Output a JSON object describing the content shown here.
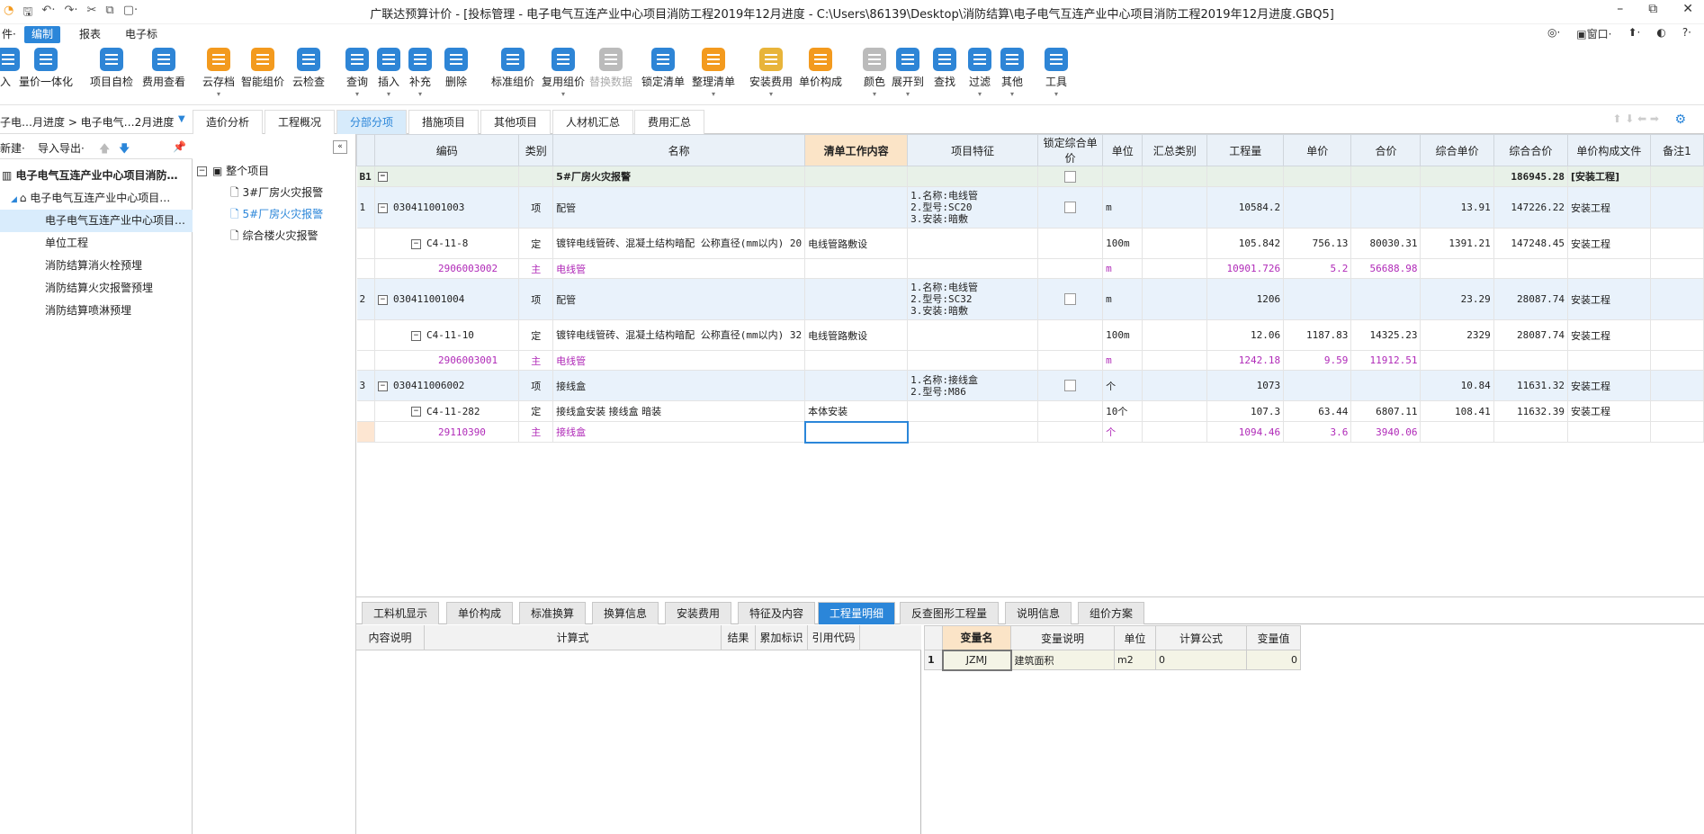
{
  "window": {
    "title": "广联达预算计价 - [投标管理 - 电子电气互连产业中心项目消防工程2019年12月进度 - C:\\Users\\86139\\Desktop\\消防结算\\电子电气互连产业中心项目消防工程2019年12月进度.GBQ5]"
  },
  "menu": {
    "items": [
      "件·",
      "编制",
      "报表",
      "电子标"
    ],
    "active": "编制",
    "right": [
      "◎·",
      "▣窗口·",
      "⬆·",
      "◐",
      "?·"
    ]
  },
  "toolbar": {
    "buttons": [
      "入",
      "量价一体化",
      "项目自检",
      "费用查看",
      "云存档",
      "智能组价",
      "云检查",
      "查询",
      "插入",
      "补充",
      "删除",
      "标准组价",
      "复用组价",
      "替换数据",
      "锁定清单",
      "整理清单",
      "安装费用",
      "单价构成",
      "颜色",
      "展开到",
      "查找",
      "过滤",
      "其他",
      "工具"
    ]
  },
  "left": {
    "breadcrumb": "子电…月进度 > 电子电气…2月进度",
    "new_label": "新建·",
    "import_label": "导入导出·",
    "tree": [
      "电子电气互连产业中心项目消防…",
      "电子电气互连产业中心项目…",
      "电子电气互连产业中心项目…",
      "单位工程",
      "消防结算消火栓预埋",
      "消防结算火灾报警预埋",
      "消防结算喷淋预埋"
    ]
  },
  "tabs": {
    "items": [
      "造价分析",
      "工程概况",
      "分部分项",
      "措施项目",
      "其他项目",
      "人材机汇总",
      "费用汇总"
    ],
    "active": "分部分项"
  },
  "mid": {
    "items": [
      "整个项目",
      "3#厂房火灾报警",
      "5#厂房火灾报警",
      "综合楼火灾报警"
    ],
    "selected": "5#厂房火灾报警"
  },
  "grid": {
    "headers": [
      "编码",
      "类别",
      "名称",
      "清单工作内容",
      "项目特征",
      "锁定综合单价",
      "单位",
      "汇总类别",
      "工程量",
      "单价",
      "合价",
      "综合单价",
      "综合合价",
      "单价构成文件",
      "备注1"
    ],
    "rows": [
      {
        "no": "B1",
        "code": "",
        "type": "",
        "name": "5#厂房火灾报警",
        "work": "",
        "feat": "",
        "unit": "",
        "qty": "",
        "price": "",
        "total": "",
        "uprice": "",
        "utotal": "186945.28",
        "file": "[安装工程]"
      },
      {
        "no": "1",
        "code": "030411001003",
        "type": "项",
        "name": "配管",
        "work": "",
        "feat": "1.名称:电线管\n2.型号:SC20\n3.安装:暗敷",
        "unit": "m",
        "qty": "10584.2",
        "price": "",
        "total": "",
        "uprice": "13.91",
        "utotal": "147226.22",
        "file": "安装工程"
      },
      {
        "no": "",
        "code": "C4-11-8",
        "type": "定",
        "name": "镀锌电线管砖、混凝土结构暗配 公称直径(mm以内) 20",
        "work": "电线管路敷设",
        "feat": "",
        "unit": "100m",
        "qty": "105.842",
        "price": "756.13",
        "total": "80030.31",
        "uprice": "1391.21",
        "utotal": "147248.45",
        "file": "安装工程"
      },
      {
        "no": "",
        "code": "2906003002",
        "type": "主",
        "name": "电线管",
        "work": "",
        "feat": "",
        "unit": "m",
        "qty": "10901.726",
        "price": "5.2",
        "total": "56688.98",
        "uprice": "",
        "utotal": "",
        "file": ""
      },
      {
        "no": "2",
        "code": "030411001004",
        "type": "项",
        "name": "配管",
        "work": "",
        "feat": "1.名称:电线管\n2.型号:SC32\n3.安装:暗敷",
        "unit": "m",
        "qty": "1206",
        "price": "",
        "total": "",
        "uprice": "23.29",
        "utotal": "28087.74",
        "file": "安装工程"
      },
      {
        "no": "",
        "code": "C4-11-10",
        "type": "定",
        "name": "镀锌电线管砖、混凝土结构暗配 公称直径(mm以内) 32",
        "work": "电线管路敷设",
        "feat": "",
        "unit": "100m",
        "qty": "12.06",
        "price": "1187.83",
        "total": "14325.23",
        "uprice": "2329",
        "utotal": "28087.74",
        "file": "安装工程"
      },
      {
        "no": "",
        "code": "2906003001",
        "type": "主",
        "name": "电线管",
        "work": "",
        "feat": "",
        "unit": "m",
        "qty": "1242.18",
        "price": "9.59",
        "total": "11912.51",
        "uprice": "",
        "utotal": "",
        "file": ""
      },
      {
        "no": "3",
        "code": "030411006002",
        "type": "项",
        "name": "接线盒",
        "work": "",
        "feat": "1.名称:接线盒\n2.型号:M86",
        "unit": "个",
        "qty": "1073",
        "price": "",
        "total": "",
        "uprice": "10.84",
        "utotal": "11631.32",
        "file": "安装工程"
      },
      {
        "no": "",
        "code": "C4-11-282",
        "type": "定",
        "name": "接线盒安装 接线盒 暗装",
        "work": "本体安装",
        "feat": "",
        "unit": "10个",
        "qty": "107.3",
        "price": "63.44",
        "total": "6807.11",
        "uprice": "108.41",
        "utotal": "11632.39",
        "file": "安装工程"
      },
      {
        "no": "",
        "code": "29110390",
        "type": "主",
        "name": "接线盒",
        "work": "",
        "feat": "",
        "unit": "个",
        "qty": "1094.46",
        "price": "3.6",
        "total": "3940.06",
        "uprice": "",
        "utotal": "",
        "file": ""
      }
    ]
  },
  "bottom_tabs": {
    "items": [
      "工料机显示",
      "单价构成",
      "标准换算",
      "换算信息",
      "安装费用",
      "特征及内容",
      "工程量明细",
      "反查图形工程量",
      "说明信息",
      "组价方案"
    ],
    "active": "工程量明细"
  },
  "qty_detail": {
    "headers": [
      "内容说明",
      "计算式",
      "结果",
      "累加标识",
      "引用代码"
    ]
  },
  "vars": {
    "headers": [
      "变量名",
      "变量说明",
      "单位",
      "计算公式",
      "变量值"
    ],
    "rows": [
      {
        "no": "1",
        "name": "JZMJ",
        "desc": "建筑面积",
        "unit": "m2",
        "formula": "0",
        "value": "0"
      }
    ]
  }
}
